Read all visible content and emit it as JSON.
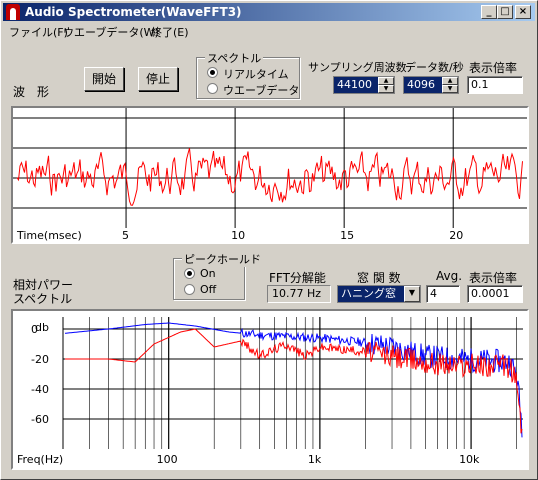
{
  "window": {
    "title": "Audio Spectrometer(WaveFFT3)"
  },
  "menu": [
    "ファイル(F)",
    "ウエーブデータ(W)",
    "終了(E)"
  ],
  "waveform": {
    "label": "波　形",
    "start_button": "開始",
    "stop_button": "停止"
  },
  "spectrum_group": {
    "title": "スペクトル",
    "options": [
      {
        "label": "リアルタイム",
        "selected": true
      },
      {
        "label": "ウエーブデータ",
        "selected": false
      }
    ]
  },
  "sampling": {
    "label": "サンプリング周波数",
    "value": "44100"
  },
  "datacount": {
    "label": "データ数/秒",
    "value": "4096"
  },
  "display_scale_top": {
    "label": "表示倍率",
    "value": "0.1"
  },
  "relative_power": {
    "label_line1": "相対パワー",
    "label_line2": "スペクトル"
  },
  "peak_hold": {
    "title": "ピークホールド",
    "options": [
      {
        "label": "On",
        "selected": true
      },
      {
        "label": "Off",
        "selected": false
      }
    ]
  },
  "fft": {
    "label": "FFT分解能",
    "value": "10.77 Hz"
  },
  "window_func": {
    "label": "窓 関 数",
    "value": "ハニング窓"
  },
  "avg": {
    "label": "Avg.",
    "value": "4"
  },
  "display_scale_bottom": {
    "label": "表示倍率",
    "value": "0.0001"
  },
  "chart_data": [
    {
      "type": "line",
      "xlabel": "Time(msec)",
      "x_ticks": [
        5,
        10,
        15,
        20
      ],
      "xlim": [
        0,
        23.2
      ],
      "series": [
        {
          "color": "#ff0000",
          "values": "noise waveform centred on 0 (approx. ±1 of display range)"
        }
      ],
      "colors": {
        "trace": "#ff0000",
        "grid": "#000000"
      }
    },
    {
      "type": "line",
      "xscale": "log",
      "xlabel": "Freq(Hz)",
      "ylabel": "db",
      "x_tick_labels": [
        "100",
        "1k",
        "10k"
      ],
      "y_tick_labels": [
        "0",
        "-20",
        "-40",
        "-60"
      ],
      "xlim": [
        20,
        22050
      ],
      "ylim": [
        -80,
        8
      ],
      "series": [
        {
          "color": "#0000ff",
          "points": [
            [
              20,
              -3
            ],
            [
              40,
              0
            ],
            [
              70,
              3
            ],
            [
              100,
              4
            ],
            [
              150,
              2
            ],
            [
              250,
              -2
            ],
            [
              400,
              -4
            ],
            [
              600,
              -5
            ],
            [
              1000,
              -6
            ],
            [
              2000,
              -9
            ],
            [
              3000,
              -12
            ],
            [
              5000,
              -18
            ],
            [
              8000,
              -20
            ],
            [
              12000,
              -21
            ],
            [
              18000,
              -22
            ],
            [
              20000,
              -30
            ],
            [
              22000,
              -70
            ]
          ]
        },
        {
          "color": "#ff0000",
          "points": [
            [
              20,
              -20
            ],
            [
              40,
              -20
            ],
            [
              60,
              -22
            ],
            [
              80,
              -10
            ],
            [
              120,
              -2
            ],
            [
              150,
              0
            ],
            [
              200,
              -12
            ],
            [
              300,
              -8
            ],
            [
              400,
              -18
            ],
            [
              600,
              -10
            ],
            [
              800,
              -18
            ],
            [
              1000,
              -12
            ],
            [
              2000,
              -15
            ],
            [
              3000,
              -18
            ],
            [
              5000,
              -22
            ],
            [
              8000,
              -24
            ],
            [
              12000,
              -24
            ],
            [
              18000,
              -25
            ],
            [
              20000,
              -35
            ],
            [
              22000,
              -75
            ]
          ]
        }
      ]
    }
  ]
}
